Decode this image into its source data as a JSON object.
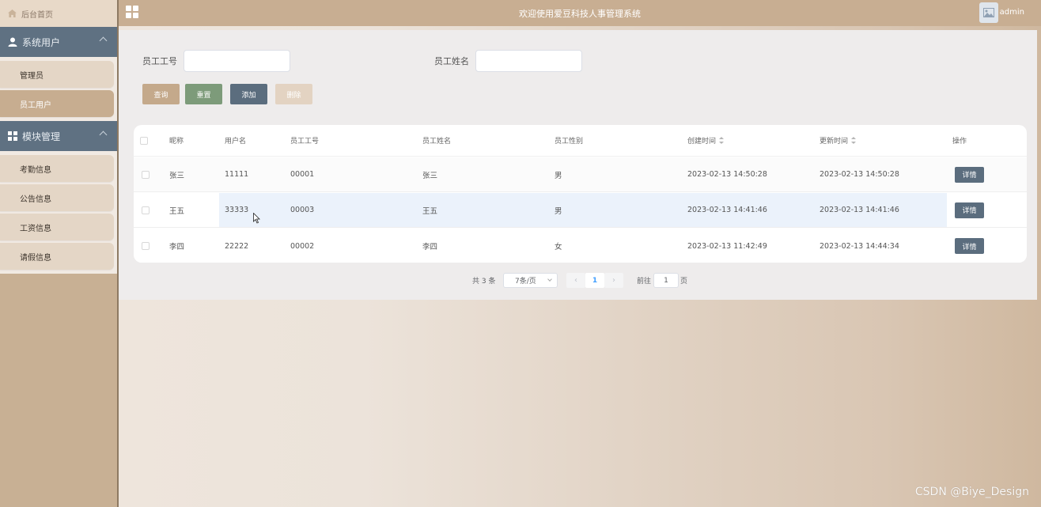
{
  "topbar": {
    "title": "欢迎使用爱豆科技人事管理系统",
    "username": "admin",
    "menu_icon": "grid-icon",
    "avatar_icon": "image-icon"
  },
  "sidebar": {
    "home_label": "后台首页",
    "home_icon": "home-icon",
    "groups": [
      {
        "label": "系统用户",
        "icon": "user-icon",
        "items": [
          {
            "label": "管理员"
          },
          {
            "label": "员工用户",
            "active": true
          }
        ]
      },
      {
        "label": "模块管理",
        "icon": "grid-icon",
        "items": [
          {
            "label": "考勤信息"
          },
          {
            "label": "公告信息"
          },
          {
            "label": "工资信息"
          },
          {
            "label": "请假信息"
          }
        ]
      }
    ]
  },
  "search": {
    "fields": [
      {
        "label": "员工工号",
        "value": ""
      },
      {
        "label": "员工姓名",
        "value": ""
      }
    ],
    "buttons": {
      "query": "查询",
      "reset": "重置",
      "add": "添加",
      "delete": "删除"
    }
  },
  "table": {
    "columns": [
      "昵称",
      "用户名",
      "员工工号",
      "员工姓名",
      "员工性别",
      "创建时间",
      "更新时间",
      "操作"
    ],
    "rows": [
      {
        "nickname": "张三",
        "username": "11111",
        "emp_no": "00001",
        "emp_name": "张三",
        "gender": "男",
        "created": "2023-02-13 14:50:28",
        "updated": "2023-02-13 14:50:28",
        "action": "详情"
      },
      {
        "nickname": "王五",
        "username": "33333",
        "emp_no": "00003",
        "emp_name": "王五",
        "gender": "男",
        "created": "2023-02-13 14:41:46",
        "updated": "2023-02-13 14:41:46",
        "action": "详情"
      },
      {
        "nickname": "李四",
        "username": "22222",
        "emp_no": "00002",
        "emp_name": "李四",
        "gender": "女",
        "created": "2023-02-13 11:42:49",
        "updated": "2023-02-13 14:44:34",
        "action": "详情"
      }
    ]
  },
  "pagination": {
    "total": "共 3 条",
    "page_size": "7条/页",
    "current_page": "1",
    "goto_label": "前往",
    "goto_value": "1",
    "page_suffix": "页",
    "prev": "‹",
    "next": "›"
  },
  "watermark": "CSDN @Biye_Design",
  "colors": {
    "sidebar_group": "#5f7182",
    "topbar": "#c8ae92",
    "btn_query": "#c4a98b",
    "btn_reset": "#7d9b7a",
    "btn_add": "#5b6d7e",
    "btn_delete": "#e3d3c2"
  }
}
